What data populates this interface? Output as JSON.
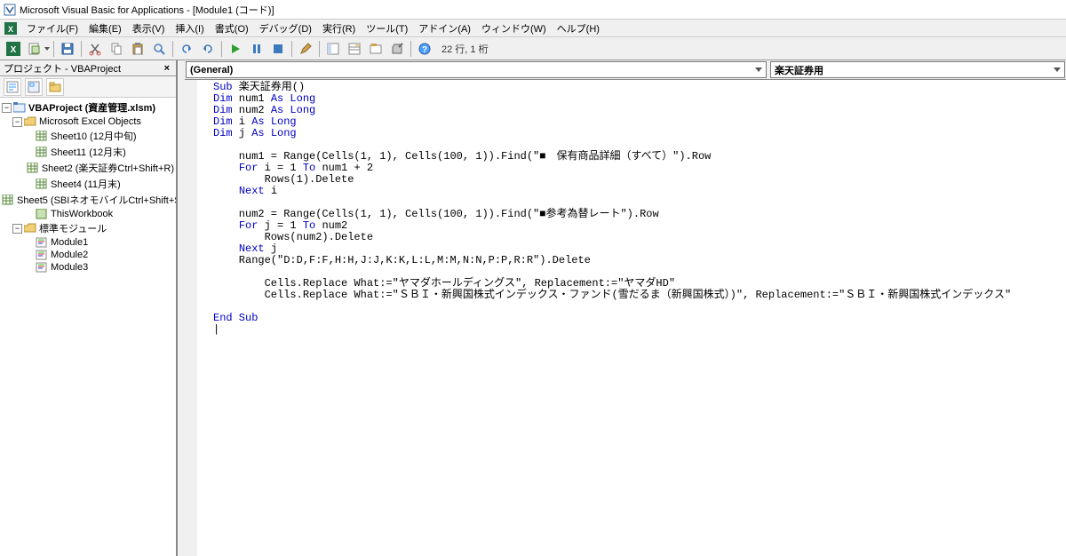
{
  "title": "Microsoft Visual Basic for Applications - [Module1 (コード)]",
  "menu": {
    "file": "ファイル(F)",
    "edit": "編集(E)",
    "view": "表示(V)",
    "insert": "挿入(I)",
    "format": "書式(O)",
    "debug": "デバッグ(D)",
    "run": "実行(R)",
    "tools": "ツール(T)",
    "addins": "アドイン(A)",
    "window": "ウィンドウ(W)",
    "help": "ヘルプ(H)"
  },
  "toolbar": {
    "status": "22 行, 1 桁"
  },
  "project_panel": {
    "title": "プロジェクト - VBAProject"
  },
  "tree": {
    "root": "VBAProject (資産管理.xlsm)",
    "folder1": "Microsoft Excel Objects",
    "s1": "Sheet10 (12月中旬)",
    "s2": "Sheet11 (12月末)",
    "s3": "Sheet2 (楽天証券Ctrl+Shift+R)",
    "s4": "Sheet4 (11月末)",
    "s5": "Sheet5 (SBIネオモバイルCtrl+Shift+S",
    "s6": "ThisWorkbook",
    "folder2": "標準モジュール",
    "m1": "Module1",
    "m2": "Module2",
    "m3": "Module3"
  },
  "dropdowns": {
    "left": "(General)",
    "right": "楽天証券用"
  },
  "code": {
    "l1a": "Sub",
    "l1b": " 楽天証券用()",
    "l2a": "Dim",
    "l2b": " num1 ",
    "l2c": "As Long",
    "l3a": "Dim",
    "l3b": " num2 ",
    "l3c": "As Long",
    "l4a": "Dim",
    "l4b": " i ",
    "l4c": "As Long",
    "l5a": "Dim",
    "l5b": " j ",
    "l5c": "As Long",
    "l7": "    num1 = Range(Cells(1, 1), Cells(100, 1)).Find(\"■　保有商品詳細（すべて）\").Row",
    "l8a": "    ",
    "l8b": "For",
    "l8c": " i = 1 ",
    "l8d": "To",
    "l8e": " num1 + 2",
    "l9": "        Rows(1).Delete",
    "l10a": "    ",
    "l10b": "Next",
    "l10c": " i",
    "l12": "    num2 = Range(Cells(1, 1), Cells(100, 1)).Find(\"■参考為替レート\").Row",
    "l13a": "    ",
    "l13b": "For",
    "l13c": " j = 1 ",
    "l13d": "To",
    "l13e": " num2",
    "l14": "        Rows(num2).Delete",
    "l15a": "    ",
    "l15b": "Next",
    "l15c": " j",
    "l16": "    Range(\"D:D,F:F,H:H,J:J,K:K,L:L,M:M,N:N,P:P,R:R\").Delete",
    "l18": "        Cells.Replace What:=\"ヤマダホールディングス\", Replacement:=\"ヤマダHD\"",
    "l19": "        Cells.Replace What:=\"ＳＢＩ・新興国株式インデックス・ファンド(雪だるま（新興国株式）)\", Replacement:=\"ＳＢＩ・新興国株式インデックス\"",
    "l21": "End Sub"
  }
}
